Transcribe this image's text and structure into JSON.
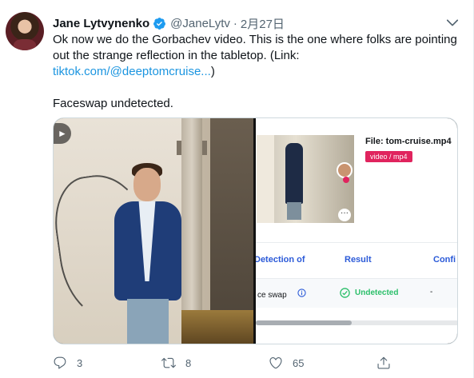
{
  "tweet": {
    "author_name": "Jane Lytvynenko",
    "author_handle": "@JaneLytv",
    "separator": "·",
    "date": "2月27日",
    "text_line1": "Ok now we do the Gorbachev video. This is the one where folks are pointing",
    "text_line2": "out the strange reflection in the tabletop. (Link:",
    "link_text": "tiktok.com/@deeptomcruise...",
    "link_close": ")",
    "text_line4": "Faceswap undetected."
  },
  "media_right": {
    "file_label": "File: tom-cruise.mp4",
    "file_badge": "video / mp4",
    "columns": [
      "Detection of",
      "Result",
      "Confi"
    ],
    "row": {
      "name": "ce swap",
      "result": "Undetected",
      "confidence": "-"
    }
  },
  "actions": {
    "reply_count": "3",
    "retweet_count": "8",
    "like_count": "65"
  },
  "colors": {
    "link": "#1b95e0",
    "verified": "#1d9bf0",
    "badge": "#e0245e",
    "undetected": "#2bbf6a",
    "column_header": "#2b5ad8"
  },
  "icons": [
    "verified-badge-icon",
    "caret-down-icon",
    "sound-icon",
    "info-icon",
    "check-circle-icon",
    "reply-icon",
    "retweet-icon",
    "like-icon",
    "share-icon"
  ]
}
